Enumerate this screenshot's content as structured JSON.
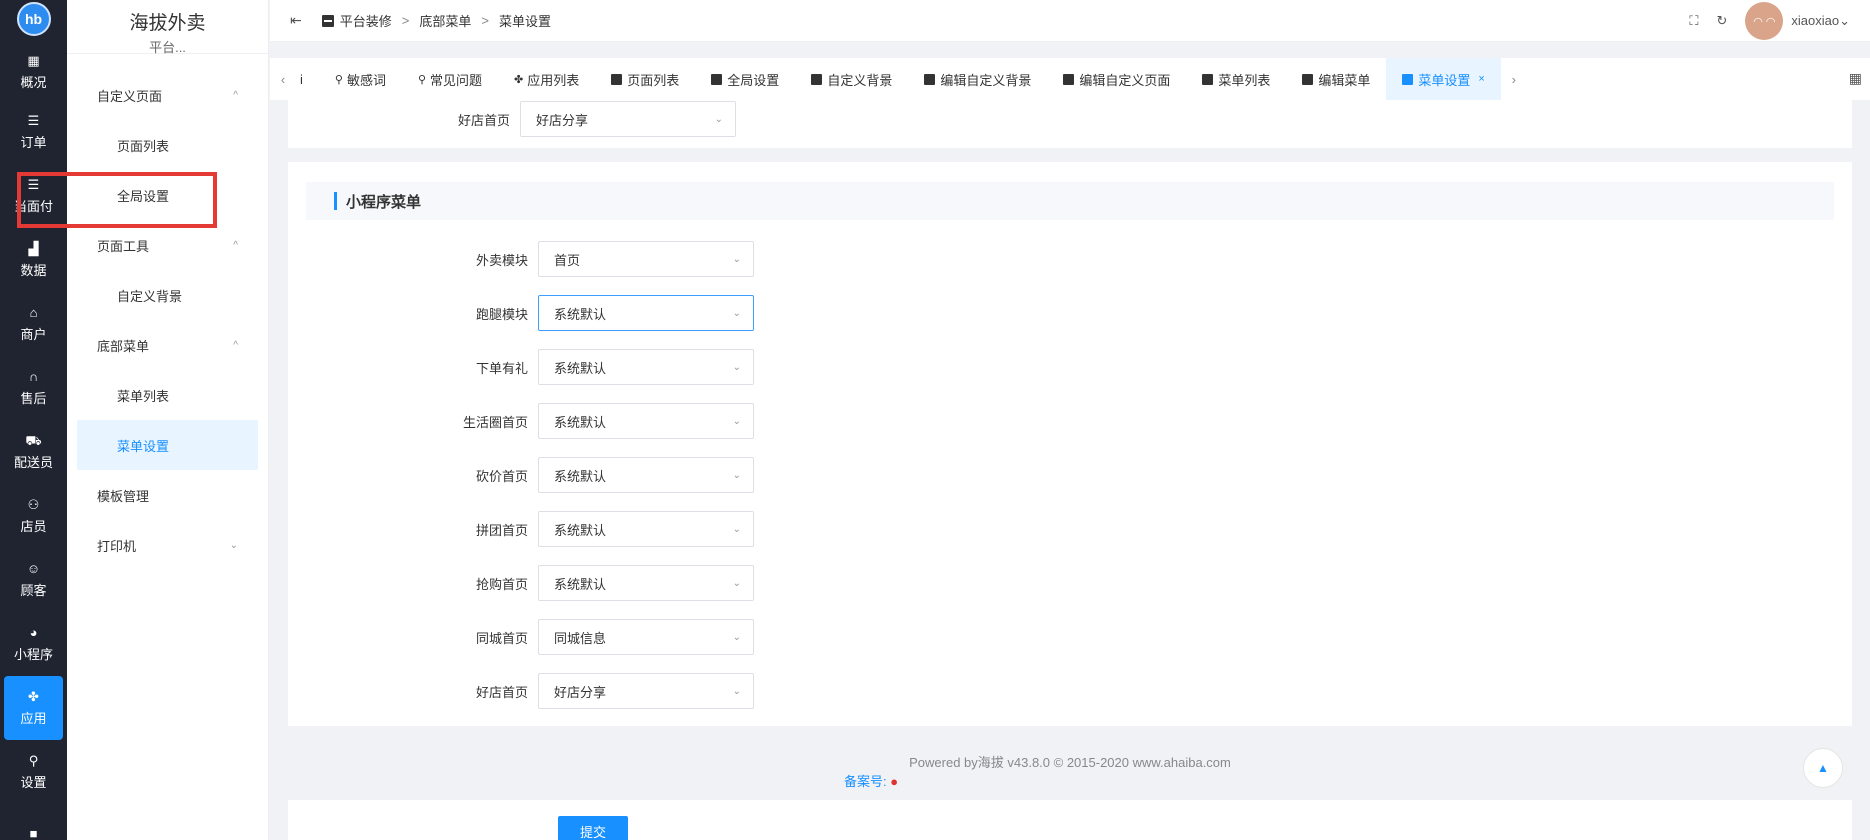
{
  "rail": {
    "logo": "hb",
    "items": [
      {
        "label": "概况",
        "icon": "dashboard-icon",
        "glyph": "▦"
      },
      {
        "label": "订单",
        "icon": "list-icon",
        "glyph": "☰"
      },
      {
        "label": "当面付",
        "icon": "list-icon",
        "glyph": "☰"
      },
      {
        "label": "数据",
        "icon": "bar-chart-icon",
        "glyph": "▟"
      },
      {
        "label": "商户",
        "icon": "store-icon",
        "glyph": "⌂"
      },
      {
        "label": "售后",
        "icon": "headset-icon",
        "glyph": "∩"
      },
      {
        "label": "配送员",
        "icon": "delivery-icon",
        "glyph": "⛟"
      },
      {
        "label": "店员",
        "icon": "users-icon",
        "glyph": "⚇"
      },
      {
        "label": "顾客",
        "icon": "customer-icon",
        "glyph": "☺"
      },
      {
        "label": "小程序",
        "icon": "wechat-icon",
        "glyph": "◕"
      },
      {
        "label": "应用",
        "icon": "apps-icon",
        "glyph": "✤"
      },
      {
        "label": "设置",
        "icon": "user-settings-icon",
        "glyph": "⚲"
      },
      {
        "label": "",
        "icon": "lock-icon",
        "glyph": "■"
      }
    ]
  },
  "sidebar": {
    "title": "海拔外卖",
    "subtitle": "平台...",
    "items": [
      {
        "label": "自定义页面",
        "type": "group",
        "chev": "^"
      },
      {
        "label": "页面列表",
        "type": "sub"
      },
      {
        "label": "全局设置",
        "type": "sub"
      },
      {
        "label": "页面工具",
        "type": "group",
        "chev": "^"
      },
      {
        "label": "自定义背景",
        "type": "sub"
      },
      {
        "label": "底部菜单",
        "type": "group",
        "chev": "^"
      },
      {
        "label": "菜单列表",
        "type": "sub"
      },
      {
        "label": "菜单设置",
        "type": "sub",
        "active": true
      },
      {
        "label": "模板管理",
        "type": "group"
      },
      {
        "label": "打印机",
        "type": "group",
        "chev": "⌄"
      }
    ]
  },
  "header": {
    "fold_icon": "⇤",
    "breadcrumb": [
      "平台装修",
      "底部菜单",
      "菜单设置"
    ],
    "separator": ">",
    "username": "xiaoxiao",
    "user_chev": "⌄",
    "avatar_text": "◠ ◠"
  },
  "tabs": {
    "left_arrow": "‹",
    "right_arrow": "›",
    "grid_glyph": "▦",
    "items": [
      {
        "label": "i",
        "kind": "none"
      },
      {
        "label": "敏感词",
        "kind": "user"
      },
      {
        "label": "常见问题",
        "kind": "user"
      },
      {
        "label": "应用列表",
        "kind": "apps"
      },
      {
        "label": "页面列表",
        "kind": "doc"
      },
      {
        "label": "全局设置",
        "kind": "doc"
      },
      {
        "label": "自定义背景",
        "kind": "doc"
      },
      {
        "label": "编辑自定义背景",
        "kind": "doc"
      },
      {
        "label": "编辑自定义页面",
        "kind": "doc"
      },
      {
        "label": "菜单列表",
        "kind": "doc"
      },
      {
        "label": "编辑菜单",
        "kind": "doc"
      },
      {
        "label": "菜单设置",
        "kind": "doc",
        "active": true,
        "close": "×"
      }
    ]
  },
  "top_card": {
    "label": "好店首页",
    "value": "好店分享"
  },
  "section": {
    "title": "小程序菜单",
    "fields": [
      {
        "label": "外卖模块",
        "value": "首页"
      },
      {
        "label": "跑腿模块",
        "value": "系统默认",
        "focused": true
      },
      {
        "label": "下单有礼",
        "value": "系统默认"
      },
      {
        "label": "生活圈首页",
        "value": "系统默认"
      },
      {
        "label": "砍价首页",
        "value": "系统默认"
      },
      {
        "label": "拼团首页",
        "value": "系统默认"
      },
      {
        "label": "抢购首页",
        "value": "系统默认"
      },
      {
        "label": "同城首页",
        "value": "同城信息"
      },
      {
        "label": "好店首页",
        "value": "好店分享"
      }
    ]
  },
  "footer": {
    "powered": "Powered by海拔 v43.8.0 © 2015-2020 www.ahaiba.com",
    "icp": "备案号:"
  },
  "back_to_top": "▲",
  "submit_label": "提交",
  "colors": {
    "accent": "#1890ff",
    "rail_bg": "#1f2430",
    "highlight_box": "#e53935"
  }
}
